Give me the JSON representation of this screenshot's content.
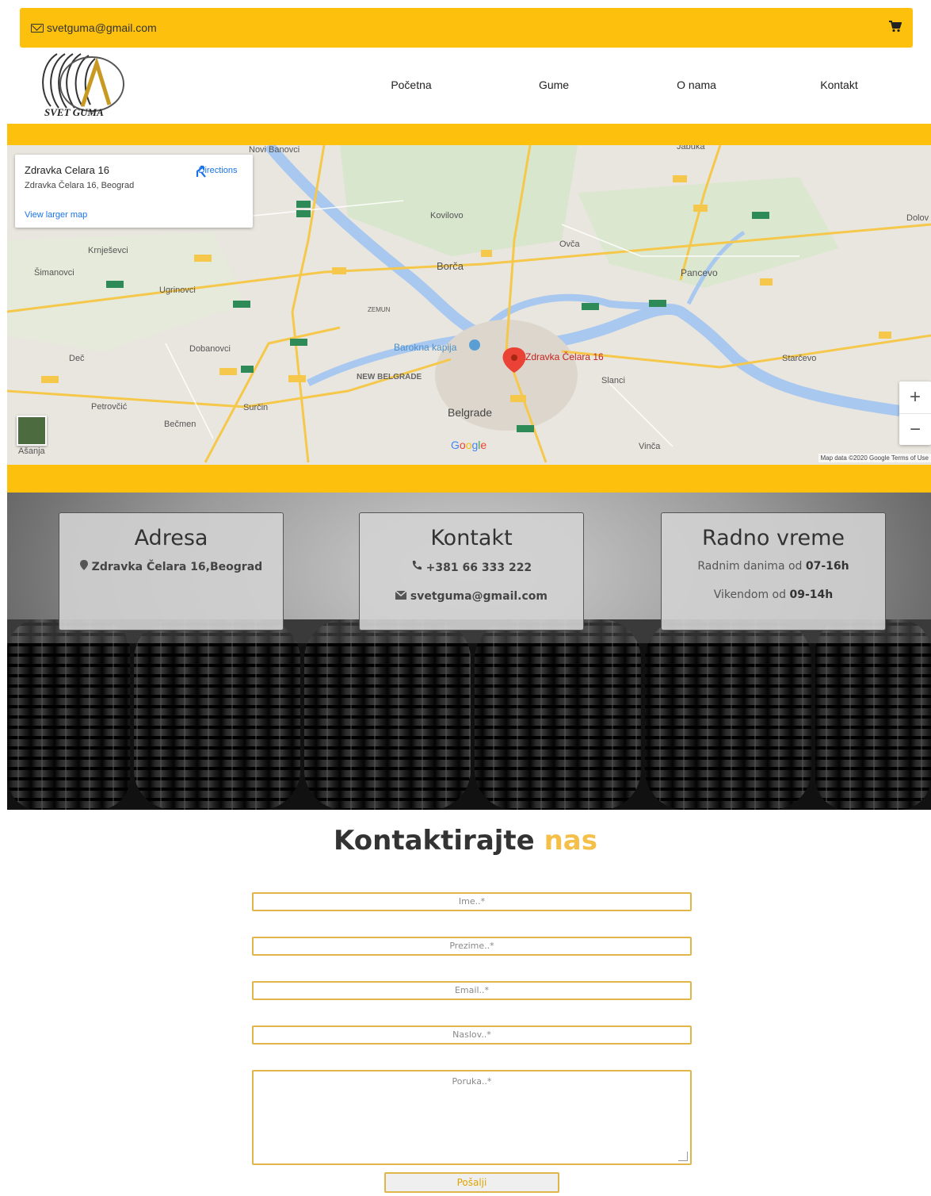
{
  "topbar": {
    "email": "svetguma@gmail.com",
    "cart_icon": "cart-icon"
  },
  "logo": {
    "text": "SVET GUMA"
  },
  "nav": [
    "Početna",
    "Gume",
    "O nama",
    "Kontakt"
  ],
  "map": {
    "card_title": "Zdravka Celara 16",
    "card_address": "Zdravka Čelara 16, Beograd",
    "directions": "Directions",
    "larger_map": "View larger map",
    "pin_label": "Zdravka Čelara 16",
    "zoom_in": "+",
    "zoom_out": "−",
    "attribution": "Map data ©2020 Google   Terms of Use",
    "google": "Google",
    "places": {
      "novi_banovci": "Novi Banovci",
      "kovilovo": "Kovilovo",
      "krnjesevci": "Krnješevci",
      "simanovci": "Šimanovci",
      "ugrinovci": "Ugrinovci",
      "borca": "Borča",
      "ovca": "Ovča",
      "pancevo": "Pancevo",
      "zemun": "ZEMUN",
      "dobanovci": "Dobanovci",
      "barokna": "Barokna kapija",
      "new_belgrade": "NEW BELGRADE",
      "dec": "Deč",
      "slanci": "Slanci",
      "starcevo": "Starčevo",
      "petrovcic": "Petrovčić",
      "surcin": "Surčin",
      "becmen": "Bečmen",
      "belgrade": "Belgrade",
      "vinca": "Vinča",
      "asanja": "Ašanja",
      "dolovo": "Dolov",
      "jabuka": "Jabuka"
    }
  },
  "cards": [
    {
      "title": "Adresa",
      "line1": "Zdravka Čelara 16,Beograd"
    },
    {
      "title": "Kontakt",
      "phone": "+381 66 333 222",
      "email": "svetguma@gmail.com"
    },
    {
      "title": "Radno vreme",
      "weekday_prefix": "Radnim danima od ",
      "weekday_hours": "07-16h",
      "weekend_prefix": "Vikendom od ",
      "weekend_hours": "09-14h"
    }
  ],
  "form": {
    "title_main": "Kontaktirajte ",
    "title_accent": "nas",
    "first_name": "Ime..*",
    "last_name": "Prezime..*",
    "email": "Email..*",
    "subject": "Naslov..*",
    "message": "Poruka..*",
    "submit": "Pošalji"
  },
  "colors": {
    "accent": "#fcc00d",
    "form_border": "#e0b64a"
  }
}
